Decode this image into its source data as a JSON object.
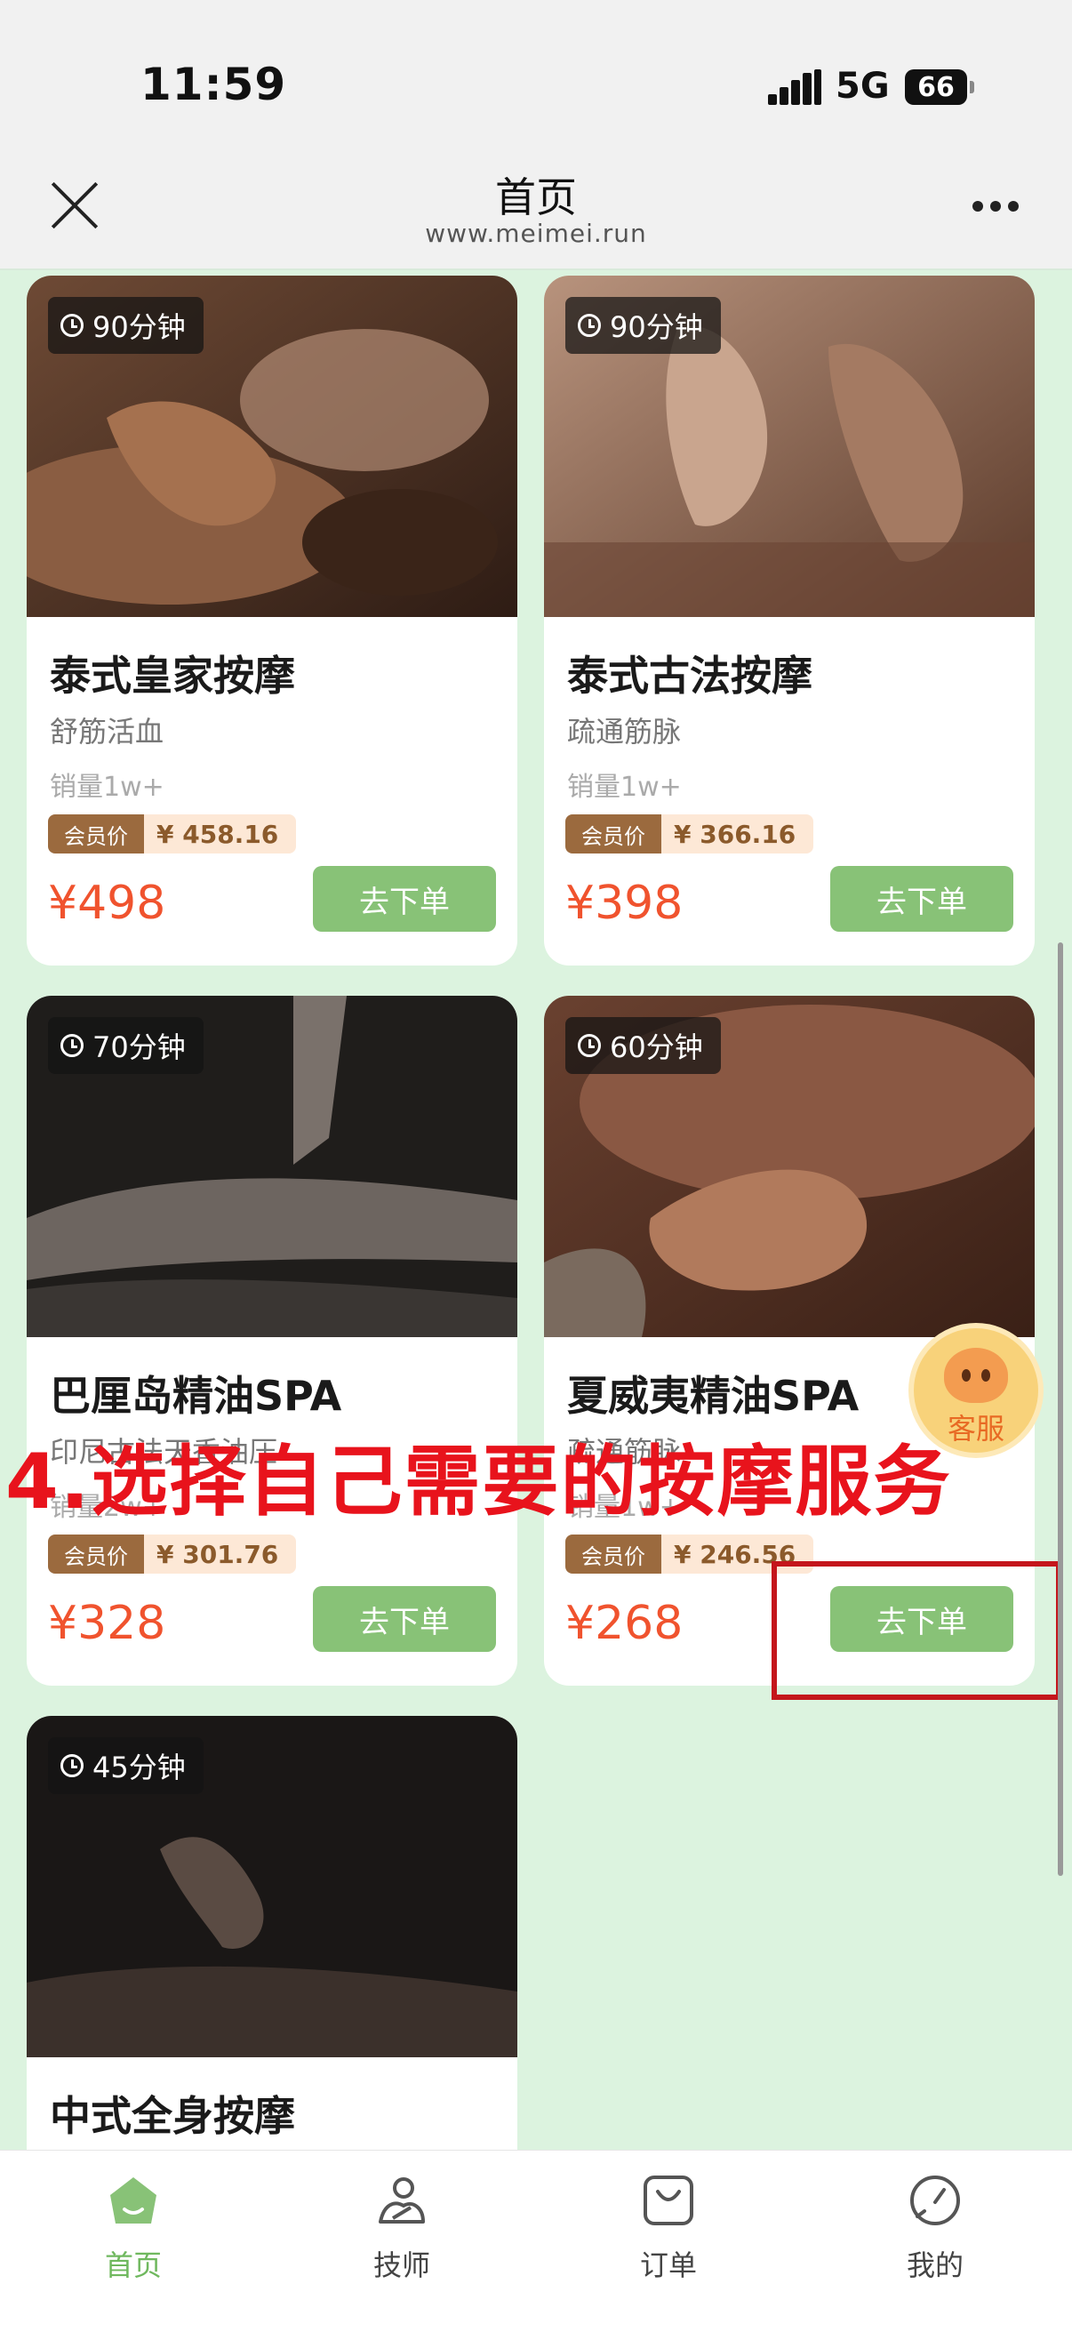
{
  "status_bar": {
    "time": "11:59",
    "network": "5G",
    "battery": "66"
  },
  "header": {
    "title": "首页",
    "url": "www.meimei.run"
  },
  "member_tag": "会员价",
  "order_label": "去下单",
  "services": [
    {
      "duration": "90分钟",
      "name": "泰式皇家按摩",
      "desc": "舒筋活血",
      "sales": "销量1w+",
      "member_price": "¥ 458.16",
      "price": "¥498"
    },
    {
      "duration": "90分钟",
      "name": "泰式古法按摩",
      "desc": "疏通筋脉",
      "sales": "销量1w+",
      "member_price": "¥ 366.16",
      "price": "¥398"
    },
    {
      "duration": "70分钟",
      "name": "巴厘岛精油SPA",
      "desc": "印尼古法天香油压",
      "sales": "销量2w+",
      "member_price": "¥ 301.76",
      "price": "¥328"
    },
    {
      "duration": "60分钟",
      "name": "夏威夷精油SPA",
      "desc": "疏通筋脉",
      "sales": "销量1w+",
      "member_price": "¥ 246.56",
      "price": "¥268"
    },
    {
      "duration": "45分钟",
      "name": "中式全身按摩"
    }
  ],
  "customer_service": "客服",
  "annotation": "4.选择自己需要的按摩服务",
  "bottom_nav": [
    {
      "label": "首页",
      "icon": "home-icon",
      "active": true
    },
    {
      "label": "技师",
      "icon": "technician-icon",
      "active": false
    },
    {
      "label": "订单",
      "icon": "order-bag-icon",
      "active": false
    },
    {
      "label": "我的",
      "icon": "profile-icon",
      "active": false
    }
  ],
  "colors": {
    "accent_green": "#88c277",
    "price_red": "#f0532e",
    "annotation_red": "#e8131c",
    "page_bg": "#dcf3df"
  }
}
